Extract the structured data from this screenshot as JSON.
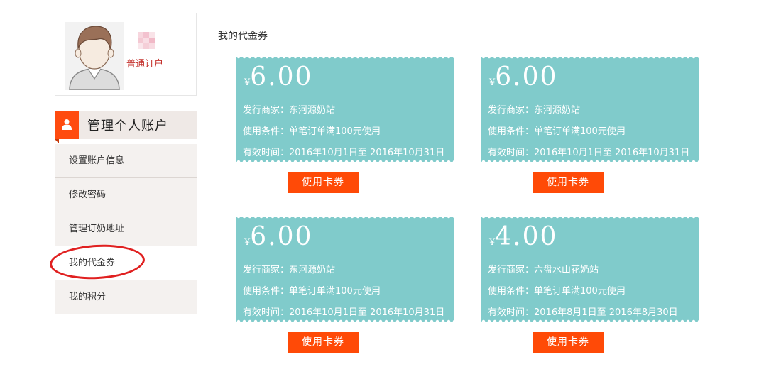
{
  "profile": {
    "level": "普通订户"
  },
  "menu": {
    "title": "管理个人账户",
    "items": [
      {
        "label": "设置账户信息"
      },
      {
        "label": "修改密码"
      },
      {
        "label": "管理订奶地址"
      },
      {
        "label": "我的代金券"
      },
      {
        "label": "我的积分"
      }
    ]
  },
  "main": {
    "title": "我的代金券"
  },
  "coupons": [
    {
      "currency": "¥",
      "value": "6.00",
      "merchant_label": "发行商家：",
      "merchant": "东河源奶站",
      "condition_label": "使用条件：",
      "condition": "单笔订单满100元使用",
      "validity_label": "有效时间：",
      "validity": "2016年10月1日至 2016年10月31日",
      "button": "使用卡券"
    },
    {
      "currency": "¥",
      "value": "6.00",
      "merchant_label": "发行商家：",
      "merchant": "东河源奶站",
      "condition_label": "使用条件：",
      "condition": "单笔订单满100元使用",
      "validity_label": "有效时间：",
      "validity": "2016年10月1日至 2016年10月31日",
      "button": "使用卡券"
    },
    {
      "currency": "¥",
      "value": "6.00",
      "merchant_label": "发行商家：",
      "merchant": "东河源奶站",
      "condition_label": "使用条件：",
      "condition": "单笔订单满100元使用",
      "validity_label": "有效时间：",
      "validity": "2016年10月1日至 2016年10月31日",
      "button": "使用卡券"
    },
    {
      "currency": "¥",
      "value": "4.00",
      "merchant_label": "发行商家：",
      "merchant": "六盘水山花奶站",
      "condition_label": "使用条件：",
      "condition": "单笔订单满100元使用",
      "validity_label": "有效时间：",
      "validity": "2016年8月1日至 2016年8月30日",
      "button": "使用卡券"
    }
  ],
  "colors": {
    "coupon_bg": "#80cbcb",
    "accent": "#ff4a07",
    "highlight_circle": "#e02020"
  },
  "icons": {
    "avatar": "user-avatar-icon",
    "menu_head": "user-icon"
  }
}
